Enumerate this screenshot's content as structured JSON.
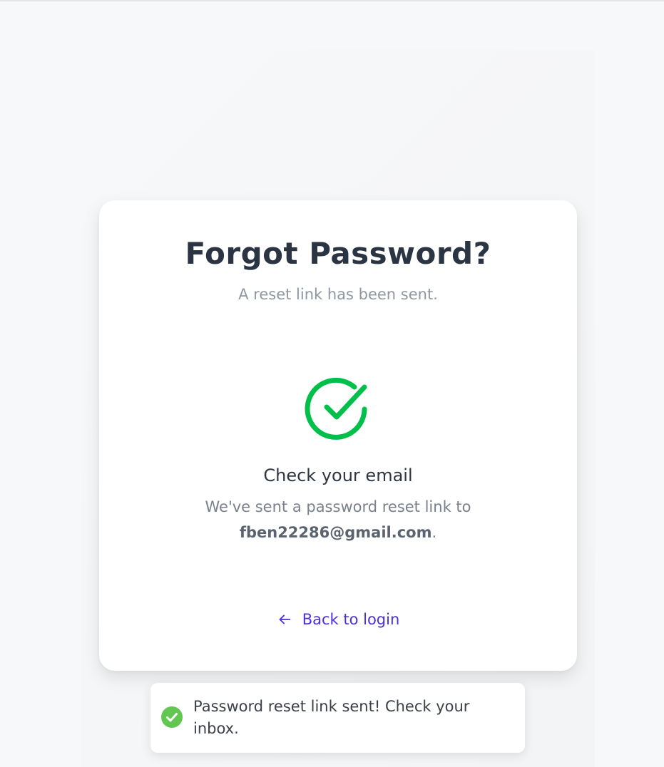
{
  "card": {
    "title": "Forgot Password?",
    "subtitle": "A reset link has been sent.",
    "success_icon": "circle-check-icon",
    "heading": "Check your email",
    "body_prefix": "We've sent a password reset link to",
    "email": "fben22286@gmail.com",
    "body_suffix": ".",
    "back_link_icon": "arrow-left-icon",
    "back_link_label": "Back to login"
  },
  "toast": {
    "icon": "check-circle-filled-icon",
    "message": "Password reset link sent! Check your inbox."
  },
  "colors": {
    "accent": "#4a2fe0",
    "success": "#00c04b",
    "toast_success": "#61c750",
    "title": "#2b3443"
  }
}
